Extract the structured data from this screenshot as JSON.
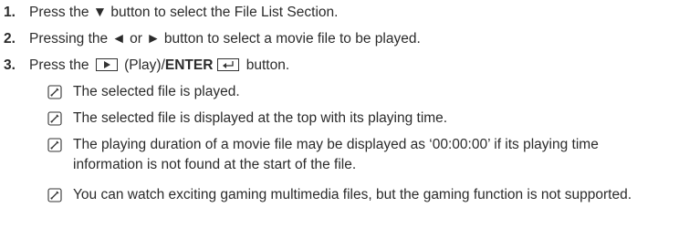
{
  "steps": [
    {
      "number": "1.",
      "text_before": "Press the ",
      "symbol": "▼",
      "text_after": " button to select the File List Section."
    },
    {
      "number": "2.",
      "text_before": "Pressing the ",
      "symbol_left": "◄",
      "middle": " or ",
      "symbol_right": "►",
      "text_after": " button to select a movie file to be played."
    },
    {
      "number": "3.",
      "text_before": "Press the ",
      "play_label": " (Play)/",
      "enter_label": "ENTER",
      "text_after": " button."
    }
  ],
  "notes": [
    "The selected file is played.",
    "The selected file is displayed at the top with its playing time.",
    "The playing duration of a movie file may be displayed as ‘00:00:00’ if its playing time information is not found at the start of the file.",
    "You can watch exciting gaming multimedia files, but the gaming function is not supported."
  ],
  "icons": {
    "note": "note-pencil-icon",
    "play_key": "play-key-icon",
    "enter_key": "enter-key-icon"
  }
}
